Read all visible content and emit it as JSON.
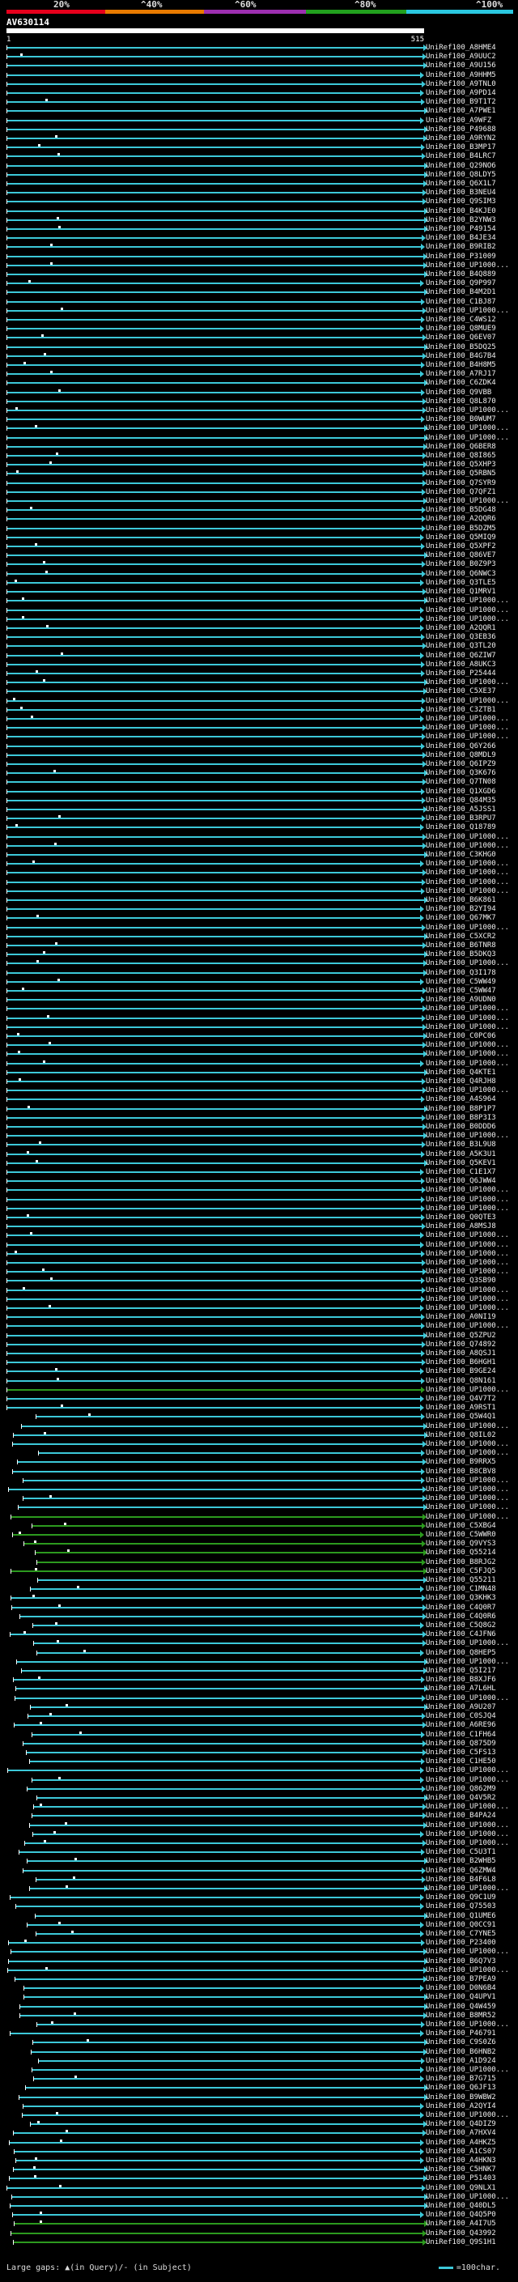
{
  "header": {
    "pct_labels": [
      "20%",
      "^40%",
      "^60%",
      "^80%",
      "^100%"
    ],
    "colors": {
      "bands": [
        "#e6001c",
        "#e87a00",
        "#9c2fb0",
        "#22a01e",
        "#2bc8e0"
      ]
    },
    "query_name": "AV630114",
    "range_start": "1",
    "range_end": "515"
  },
  "colors": {
    "hit_cyan": "#3cc8d8",
    "hit_green": "#2c9a1e",
    "tick": "#ffffff",
    "arrow": "#3cc8d8"
  },
  "hits": [
    "UniRef100_A8HME4",
    "UniRef100_A9UUC2",
    "UniRef100_A9U156",
    "UniRef100_A9HHM5",
    "UniRef100_A9TNL0",
    "UniRef100_A9PD14",
    "UniRef100_B9T1T2",
    "UniRef100_A7PWE1",
    "UniRef100_A9WFZ",
    "UniRef100_P49688",
    "UniRef100_A9RYN2",
    "UniRef100_B3MP17",
    "UniRef100_B4LRC7",
    "UniRef100_Q29NO6",
    "UniRef100_Q8LDY5",
    "UniRef100_Q6X1L7",
    "UniRef100_B3NEU4",
    "UniRef100_Q9SIM3",
    "UniRef100_B4KJE0",
    "UniRef100_B2YNW3",
    "UniRef100_P49154",
    "UniRef100_B4JE34",
    "UniRef100_B9RIB2",
    "UniRef100_P31009",
    "UniRef100_UP1000...",
    "UniRef100_B4Q889",
    "UniRef100_Q9P997",
    "UniRef100_B4M2D1",
    "UniRef100_C1BJ87",
    "UniRef100_UP1000...",
    "UniRef100_C4WS12",
    "UniRef100_Q8MUE9",
    "UniRef100_Q6EV07",
    "UniRef100_B5DQ25",
    "UniRef100_B4G7B4",
    "UniRef100_B4H8M5",
    "UniRef100_A7RJ17",
    "UniRef100_C6ZDK4",
    "UniRef100_Q9VBB",
    "UniRef100_Q8L870",
    "UniRef100_UP1000...",
    "UniRef100_B0WUM7",
    "UniRef100_UP1000...",
    "UniRef100_UP1000...",
    "UniRef100_Q6BER8",
    "UniRef100_Q8I865",
    "UniRef100_Q5XHP3",
    "UniRef100_Q5RBN5",
    "UniRef100_Q7SYR9",
    "UniRef100_Q7QFZ1",
    "UniRef100_UP1000...",
    "UniRef100_B5DG48",
    "UniRef100_A2QQR6",
    "UniRef100_B5DZM5",
    "UniRef100_Q5MIQ9",
    "UniRef100_Q5XPF2",
    "UniRef100_Q86VE7",
    "UniRef100_B0Z9P3",
    "UniRef100_Q6NWC3",
    "UniRef100_Q3TLE5",
    "UniRef100_Q1MRV1",
    "UniRef100_UP1000...",
    "UniRef100_UP1000...",
    "UniRef100_UP1000...",
    "UniRef100_A2QQR1",
    "UniRef100_Q3EB36",
    "UniRef100_Q3TL20",
    "UniRef100_Q6ZIW7",
    "UniRef100_A8UKC3",
    "UniRef100_P25444",
    "UniRef100_UP1000...",
    "UniRef100_C5XE37",
    "UniRef100_UP1000...",
    "UniRef100_C3ZTB1",
    "UniRef100_UP1000...",
    "UniRef100_UP1000...",
    "UniRef100_UP1000...",
    "UniRef100_Q6Y266",
    "UniRef100_Q8MDL9",
    "UniRef100_Q6IPZ9",
    "UniRef100_Q3K676",
    "UniRef100_Q7TN08",
    "UniRef100_Q1XGD6",
    "UniRef100_Q84M35",
    "UniRef100_A5JSS1",
    "UniRef100_B3RPU7",
    "UniRef100_Q18789",
    "UniRef100_UP1000...",
    "UniRef100_UP1000...",
    "UniRef100_C3KHG0",
    "UniRef100_UP1000...",
    "UniRef100_UP1000...",
    "UniRef100_UP1000...",
    "UniRef100_UP1000...",
    "UniRef100_B6K861",
    "UniRef100_B2YI94",
    "UniRef100_Q67MK7",
    "UniRef100_UP1000...",
    "UniRef100_C5XCR2",
    "UniRef100_B6TNR8",
    "UniRef100_B5DKQ3",
    "UniRef100_UP1000...",
    "UniRef100_Q3I178",
    "UniRef100_C5WW49",
    "UniRef100_C5WW47",
    "UniRef100_A9UDN0",
    "UniRef100_UP1000...",
    "UniRef100_UP1000...",
    "UniRef100_UP1000...",
    "UniRef100_C0PC06",
    "UniRef100_UP1000...",
    "UniRef100_UP1000...",
    "UniRef100_UP1000...",
    "UniRef100_Q4KTE1",
    "UniRef100_Q4RJH8",
    "UniRef100_UP1000...",
    "UniRef100_A4S964",
    "UniRef100_B8P1P7",
    "UniRef100_B8P3I3",
    "UniRef100_B0DDD6",
    "UniRef100_UP1000...",
    "UniRef100_B3L9U8",
    "UniRef100_A5K3U1",
    "UniRef100_Q5KEV1",
    "UniRef100_C1E1X7",
    "UniRef100_Q6JWW4",
    "UniRef100_UP1000...",
    "UniRef100_UP1000...",
    "UniRef100_UP1000...",
    "UniRef100_Q0QTE3",
    "UniRef100_A8MSJ8",
    "UniRef100_UP1000...",
    "UniRef100_UP1000...",
    "UniRef100_UP1000...",
    "UniRef100_UP1000...",
    "UniRef100_UP1000...",
    "UniRef100_Q3SB90",
    "UniRef100_UP1000...",
    "UniRef100_UP1000...",
    "UniRef100_UP1000...",
    "UniRef100_A0NI19",
    "UniRef100_UP1000...",
    "UniRef100_Q5ZPU2",
    "UniRef100_Q74892",
    "UniRef100_A8QSJ1",
    "UniRef100_B6HGH1",
    "UniRef100_B9GE24",
    "UniRef100_Q8N161",
    "UniRef100_UP1000...",
    "UniRef100_Q4V7T2",
    "UniRef100_A9RST1",
    "UniRef100_Q5W4Q1",
    "UniRef100_UP1000...",
    "UniRef100_Q8IL02",
    "UniRef100_UP1000...",
    "UniRef100_UP1000...",
    "UniRef100_B9RRX5",
    "UniRef100_B8CBV8",
    "UniRef100_UP1000...",
    "UniRef100_UP1000...",
    "UniRef100_UP1000...",
    "UniRef100_UP1000...",
    "UniRef100_UP1000...",
    "UniRef100_C5XBG4",
    "UniRef100_C5WWR0",
    "UniRef100_Q9VYS3",
    "UniRef100_Q55214",
    "UniRef100_B8RJG2",
    "UniRef100_C5FJQ5",
    "UniRef100_Q55211",
    "UniRef100_C1MN48",
    "UniRef100_Q3KHK3",
    "UniRef100_C4Q0R7",
    "UniRef100_C4Q0R6",
    "UniRef100_C5Q8G2",
    "UniRef100_C4JFN6",
    "UniRef100_UP1000...",
    "UniRef100_Q8HEP5",
    "UniRef100_UP1000...",
    "UniRef100_Q5I217",
    "UniRef100_B8XJF6",
    "UniRef100_A7L6HL",
    "UniRef100_UP1000...",
    "UniRef100_A9U207",
    "UniRef100_C0SJQ4",
    "UniRef100_A6RE96",
    "UniRef100_C1FH64",
    "UniRef100_Q875D9",
    "UniRef100_C5FS13",
    "UniRef100_C1HE50",
    "UniRef100_UP1000...",
    "UniRef100_UP1000...",
    "UniRef100_Q862M9",
    "UniRef100_Q4V5R2",
    "UniRef100_UP1000...",
    "UniRef100_B4PA24",
    "UniRef100_UP1000...",
    "UniRef100_UP1000...",
    "UniRef100_UP1000...",
    "UniRef100_C5U3T1",
    "UniRef100_B2WHB5",
    "UniRef100_Q6ZMW4",
    "UniRef100_B4F6L8",
    "UniRef100_UP1000...",
    "UniRef100_Q9C1U9",
    "UniRef100_Q75503",
    "UniRef100_Q1UME6",
    "UniRef100_Q0CC91",
    "UniRef100_C7YNE5",
    "UniRef100_P23400",
    "UniRef100_UP1000...",
    "UniRef100_B6Q7V3",
    "UniRef100_UP1000...",
    "UniRef100_B7PEA9",
    "UniRef100_D0N6B4",
    "UniRef100_Q4UPV1",
    "UniRef100_Q4W459",
    "UniRef100_B8MR52",
    "UniRef100_UP1000...",
    "UniRef100_P46791",
    "UniRef100_C9S0Z6",
    "UniRef100_B6HNB2",
    "UniRef100_A1D924",
    "UniRef100_UP1000...",
    "UniRef100_B7G715",
    "UniRef100_Q6JF13",
    "UniRef100_B9WBW2",
    "UniRef100_A2QYI4",
    "UniRef100_UP1000...",
    "UniRef100_Q4DIZ9",
    "UniRef100_A7HXV4",
    "UniRef100_A4HKZ5",
    "UniRef100_A1CS07",
    "UniRef100_A4HKN3",
    "UniRef100_C5HNK7",
    "UniRef100_P51403",
    "UniRef100_Q9NLX1",
    "UniRef100_UP1000...",
    "UniRef100_Q40DL5",
    "UniRef100_Q4Q5P0",
    "UniRef100_A4I7U5",
    "UniRef100_Q43992",
    "UniRef100_Q9S1H1"
  ],
  "footer": {
    "left_label": "Large gaps:",
    "left_symbols": "▲(in Query)/- (in Subject)",
    "right_label": "=100char."
  }
}
